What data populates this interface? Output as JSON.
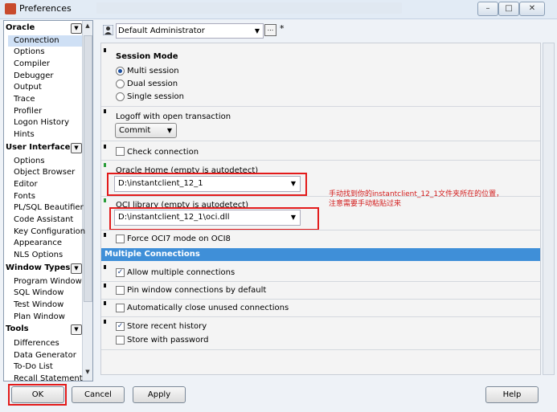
{
  "window": {
    "title": "Preferences",
    "controls": {
      "minimize": "–",
      "maximize": "□",
      "close": "✕"
    }
  },
  "sidebar": {
    "categories": [
      {
        "label": "Oracle",
        "items": [
          "Connection",
          "Options",
          "Compiler",
          "Debugger",
          "Output",
          "Trace",
          "Profiler",
          "Logon History",
          "Hints"
        ]
      },
      {
        "label": "User Interface",
        "items": [
          "Options",
          "Object Browser",
          "Editor",
          "Fonts",
          "PL/SQL Beautifier",
          "Code Assistant",
          "Key Configuration",
          "Appearance",
          "NLS Options"
        ]
      },
      {
        "label": "Window Types",
        "items": [
          "Program Window",
          "SQL Window",
          "Test Window",
          "Plan Window"
        ]
      },
      {
        "label": "Tools",
        "items": [
          "Differences",
          "Data Generator",
          "To-Do List",
          "Recall Statement"
        ]
      }
    ],
    "selected": "Connection"
  },
  "profile": {
    "value": "Default Administrator",
    "ellipsis": "...",
    "modified_marker": "*"
  },
  "session_mode": {
    "title": "Session Mode",
    "options": [
      "Multi session",
      "Dual session",
      "Single session"
    ],
    "selected": "Multi session"
  },
  "logoff": {
    "label": "Logoff with open transaction",
    "value": "Commit"
  },
  "check_connection": {
    "label": "Check connection",
    "checked": false
  },
  "oracle_home": {
    "label": "Oracle Home (empty is autodetect)",
    "value": "D:\\instantclient_12_1"
  },
  "oci_library": {
    "label": "OCI library (empty is autodetect)",
    "value": "D:\\instantclient_12_1\\oci.dll"
  },
  "annotation": {
    "line1": "手动找到你的instantclient_12_1文件夹所在的位置，",
    "line2": "注意需要手动粘贴过来",
    "color": "#d21a1a"
  },
  "force_oci7": {
    "label": "Force OCI7 mode on OCI8",
    "checked": false
  },
  "multiple_connections": {
    "header": "Multiple Connections",
    "allow_multiple": {
      "label": "Allow multiple connections",
      "checked": true
    },
    "pin_window": {
      "label": "Pin window connections by default",
      "checked": false
    },
    "auto_close": {
      "label": "Automatically close unused connections",
      "checked": false
    },
    "store_history": {
      "label": "Store recent history",
      "checked": true
    },
    "store_password": {
      "label": "Store with password",
      "checked": false
    }
  },
  "buttons": {
    "ok": "OK",
    "cancel": "Cancel",
    "apply": "Apply",
    "help": "Help"
  },
  "colors": {
    "accent": "#3f8fd8",
    "highlight_red": "#e31b1b",
    "selected_bg": "#cfe0f5"
  },
  "icons": {
    "app": "preferences-app-icon",
    "profile": "user-profile-icon"
  }
}
